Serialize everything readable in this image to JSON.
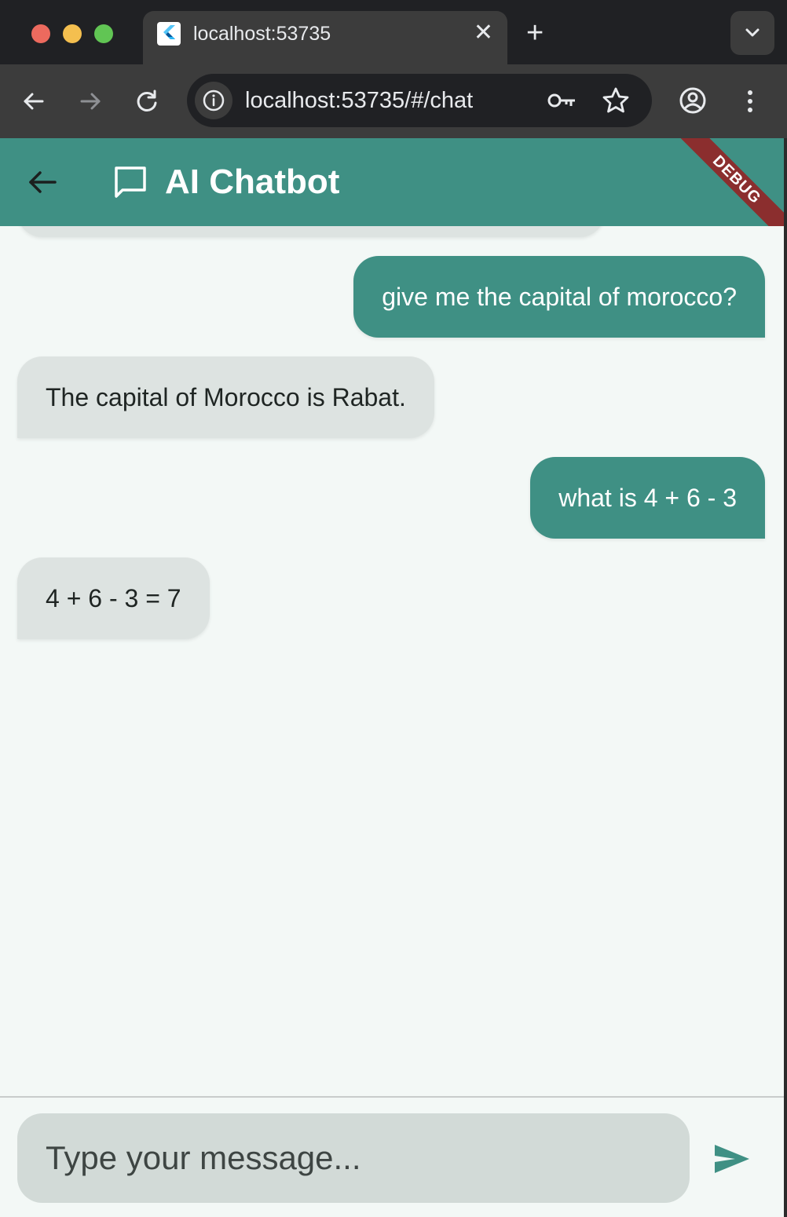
{
  "browser": {
    "tab_title": "localhost:53735",
    "url": "localhost:53735/#/chat"
  },
  "appbar": {
    "title": "AI Chatbot",
    "debug_banner": "DEBUG",
    "color": "#3f9084"
  },
  "messages": [
    {
      "role": "user",
      "text": "give me the capital of morocco?"
    },
    {
      "role": "bot",
      "text": "The capital of Morocco is Rabat."
    },
    {
      "role": "user",
      "text": "what is 4 + 6 - 3"
    },
    {
      "role": "bot",
      "text": "4 + 6 - 3 = 7"
    }
  ],
  "composer": {
    "placeholder": "Type your message..."
  }
}
